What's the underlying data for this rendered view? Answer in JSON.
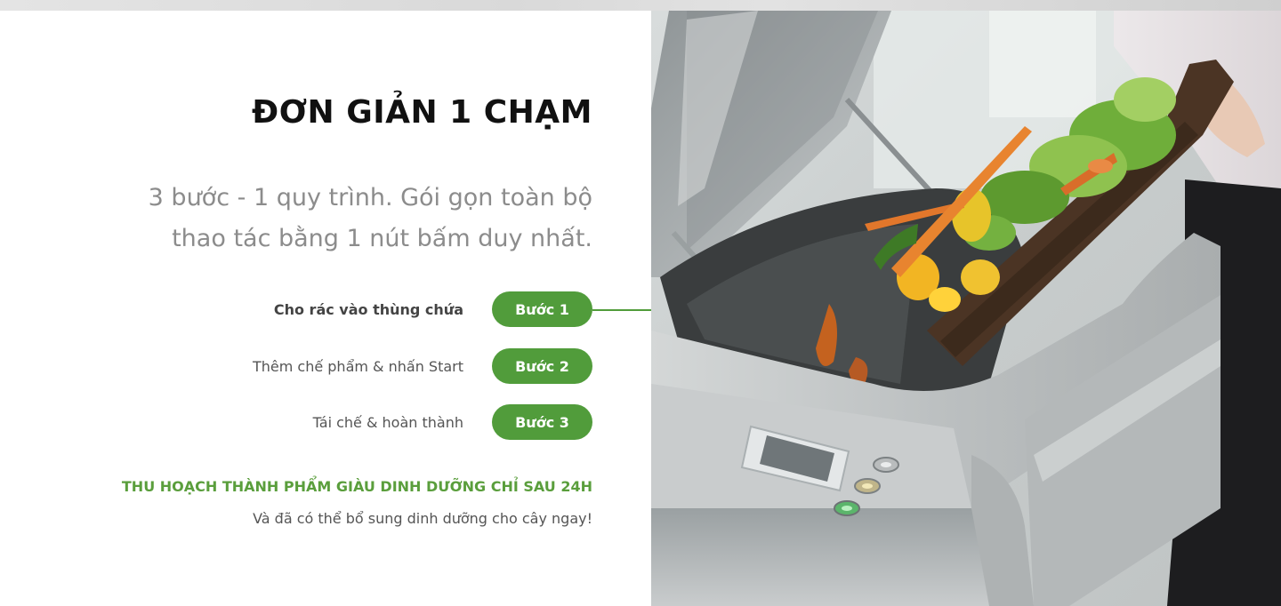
{
  "headline": "ĐƠN GIẢN 1 CHẠM",
  "subtitle": "3 bước - 1 quy trình. Gói gọn toàn bộ thao tác bằng 1 nút bấm duy nhất.",
  "steps": [
    {
      "text": "Cho rác vào thùng chứa",
      "label": "Bước 1",
      "active": true
    },
    {
      "text": "Thêm chế phẩm & nhấn Start",
      "label": "Bước 2",
      "active": false
    },
    {
      "text": "Tái chế & hoàn thành",
      "label": "Bước 3",
      "active": false
    }
  ],
  "harvest": {
    "title": "THU HOẠCH THÀNH PHẨM GIÀU DINH DƯỠNG CHỈ SAU 24H",
    "subtitle": "Và đã có thể bổ sung dinh dưỡng cho cây ngay!"
  },
  "colors": {
    "accent": "#519c3b",
    "heading": "#111111",
    "subtitle": "#8c8c8c",
    "body": "#555555"
  }
}
